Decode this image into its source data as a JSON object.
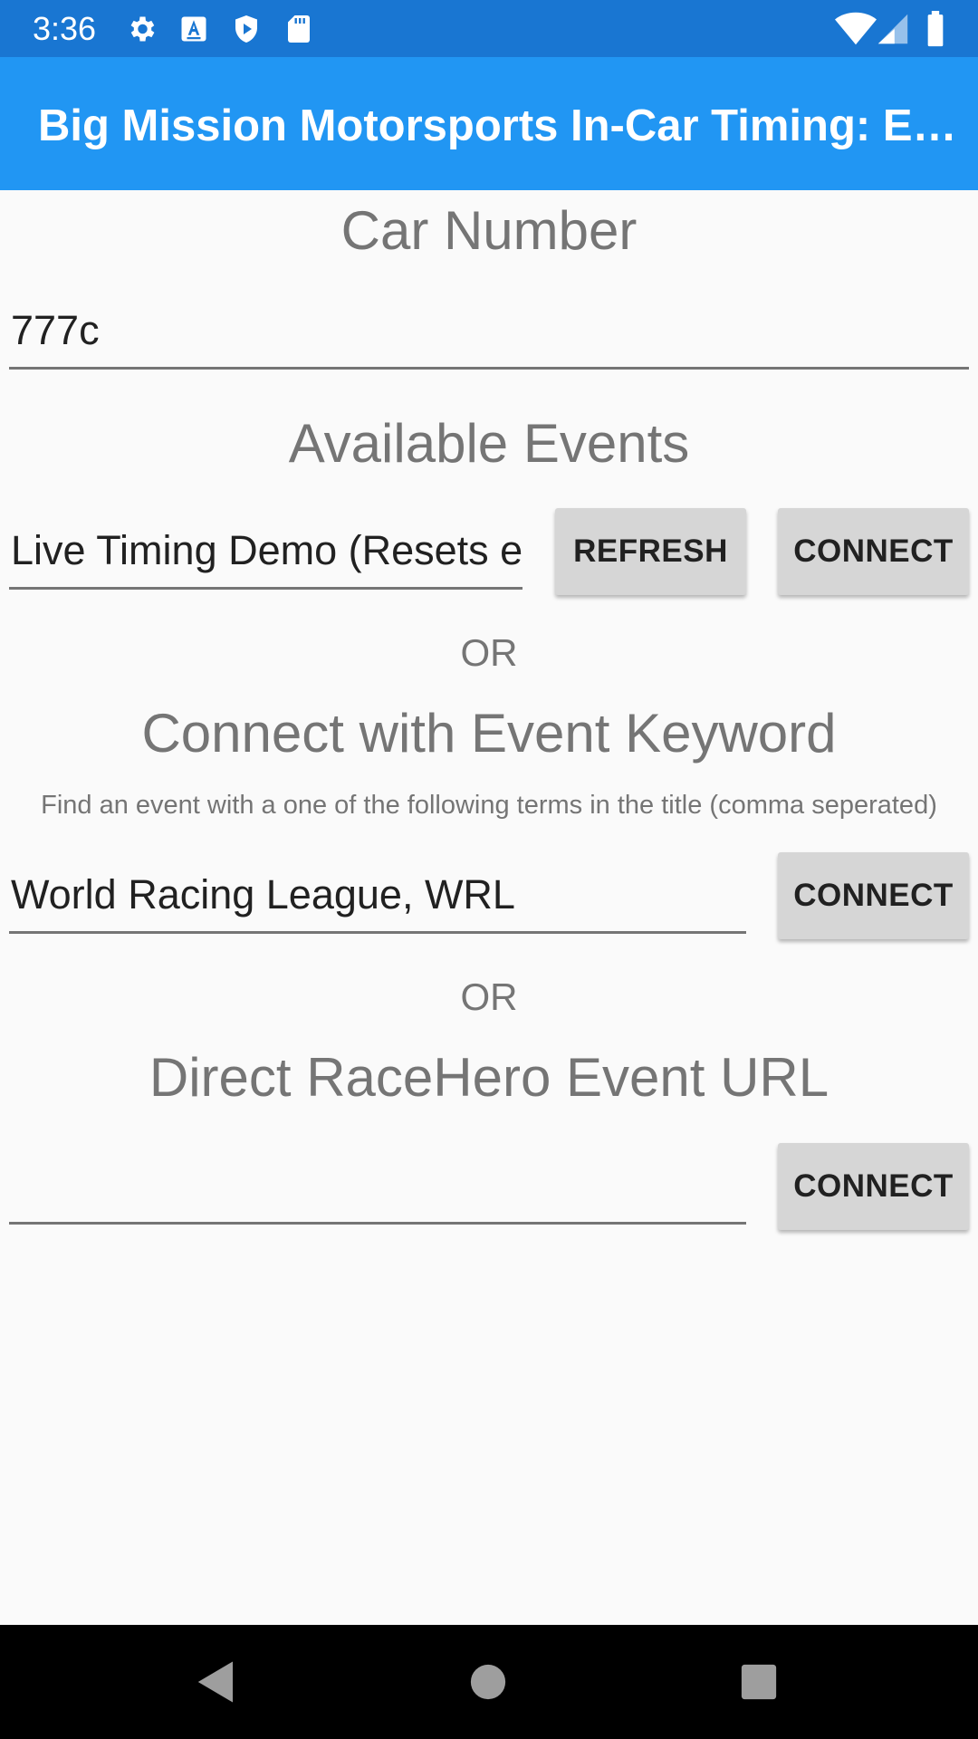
{
  "status_bar": {
    "time": "3:36",
    "icons": [
      "settings-gear-icon",
      "a-accessibility-icon",
      "shield-play-icon",
      "sd-card-icon"
    ],
    "right_icons": [
      "wifi-icon",
      "cellular-signal-icon",
      "battery-icon"
    ],
    "color": "#1976d2"
  },
  "app_bar": {
    "title": "Big Mission Motorsports In-Car Timing: E…",
    "color": "#2196f3"
  },
  "car_number": {
    "heading": "Car Number",
    "value": "777c"
  },
  "available_events": {
    "heading": "Available Events",
    "selected_event": "Live Timing Demo (Resets e",
    "refresh_label": "REFRESH",
    "connect_label": "CONNECT"
  },
  "or_label_1": "OR",
  "keyword": {
    "heading": "Connect with Event Keyword",
    "hint": "Find an event with a one of the following terms in the title (comma seperated)",
    "value": "World Racing League, WRL",
    "connect_label": "CONNECT"
  },
  "or_label_2": "OR",
  "direct_url": {
    "heading": "Direct RaceHero Event URL",
    "value": "",
    "connect_label": "CONNECT"
  },
  "nav_bar": {
    "icons": [
      "back-icon",
      "home-icon",
      "recents-icon"
    ]
  }
}
